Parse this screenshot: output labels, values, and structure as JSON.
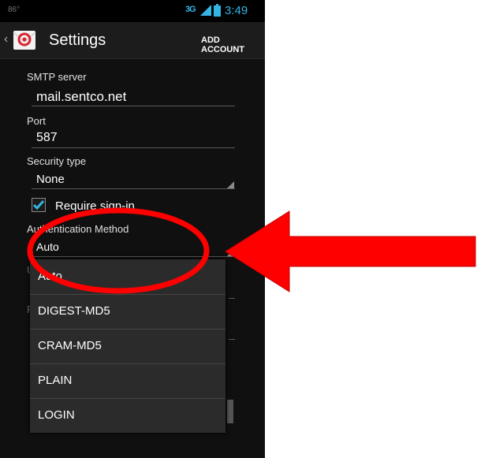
{
  "status_bar": {
    "left_text": "86°",
    "network": "3G",
    "time": "3:49"
  },
  "action_bar": {
    "title": "Settings",
    "add_account": "ADD ACCOUNT"
  },
  "form": {
    "smtp_label": "SMTP server",
    "smtp_value": "mail.sentco.net",
    "port_label": "Port",
    "port_value": "587",
    "security_label": "Security type",
    "security_value": "None",
    "require_signin_label": "Require sign-in",
    "require_signin_checked": true,
    "auth_label": "Authentication Method",
    "auth_value": "Auto"
  },
  "auth_options": [
    "Auto",
    "DIGEST-MD5",
    "CRAM-MD5",
    "PLAIN",
    "LOGIN"
  ],
  "colors": {
    "accent": "#33b5e5",
    "annotation_red": "#ff0000"
  }
}
